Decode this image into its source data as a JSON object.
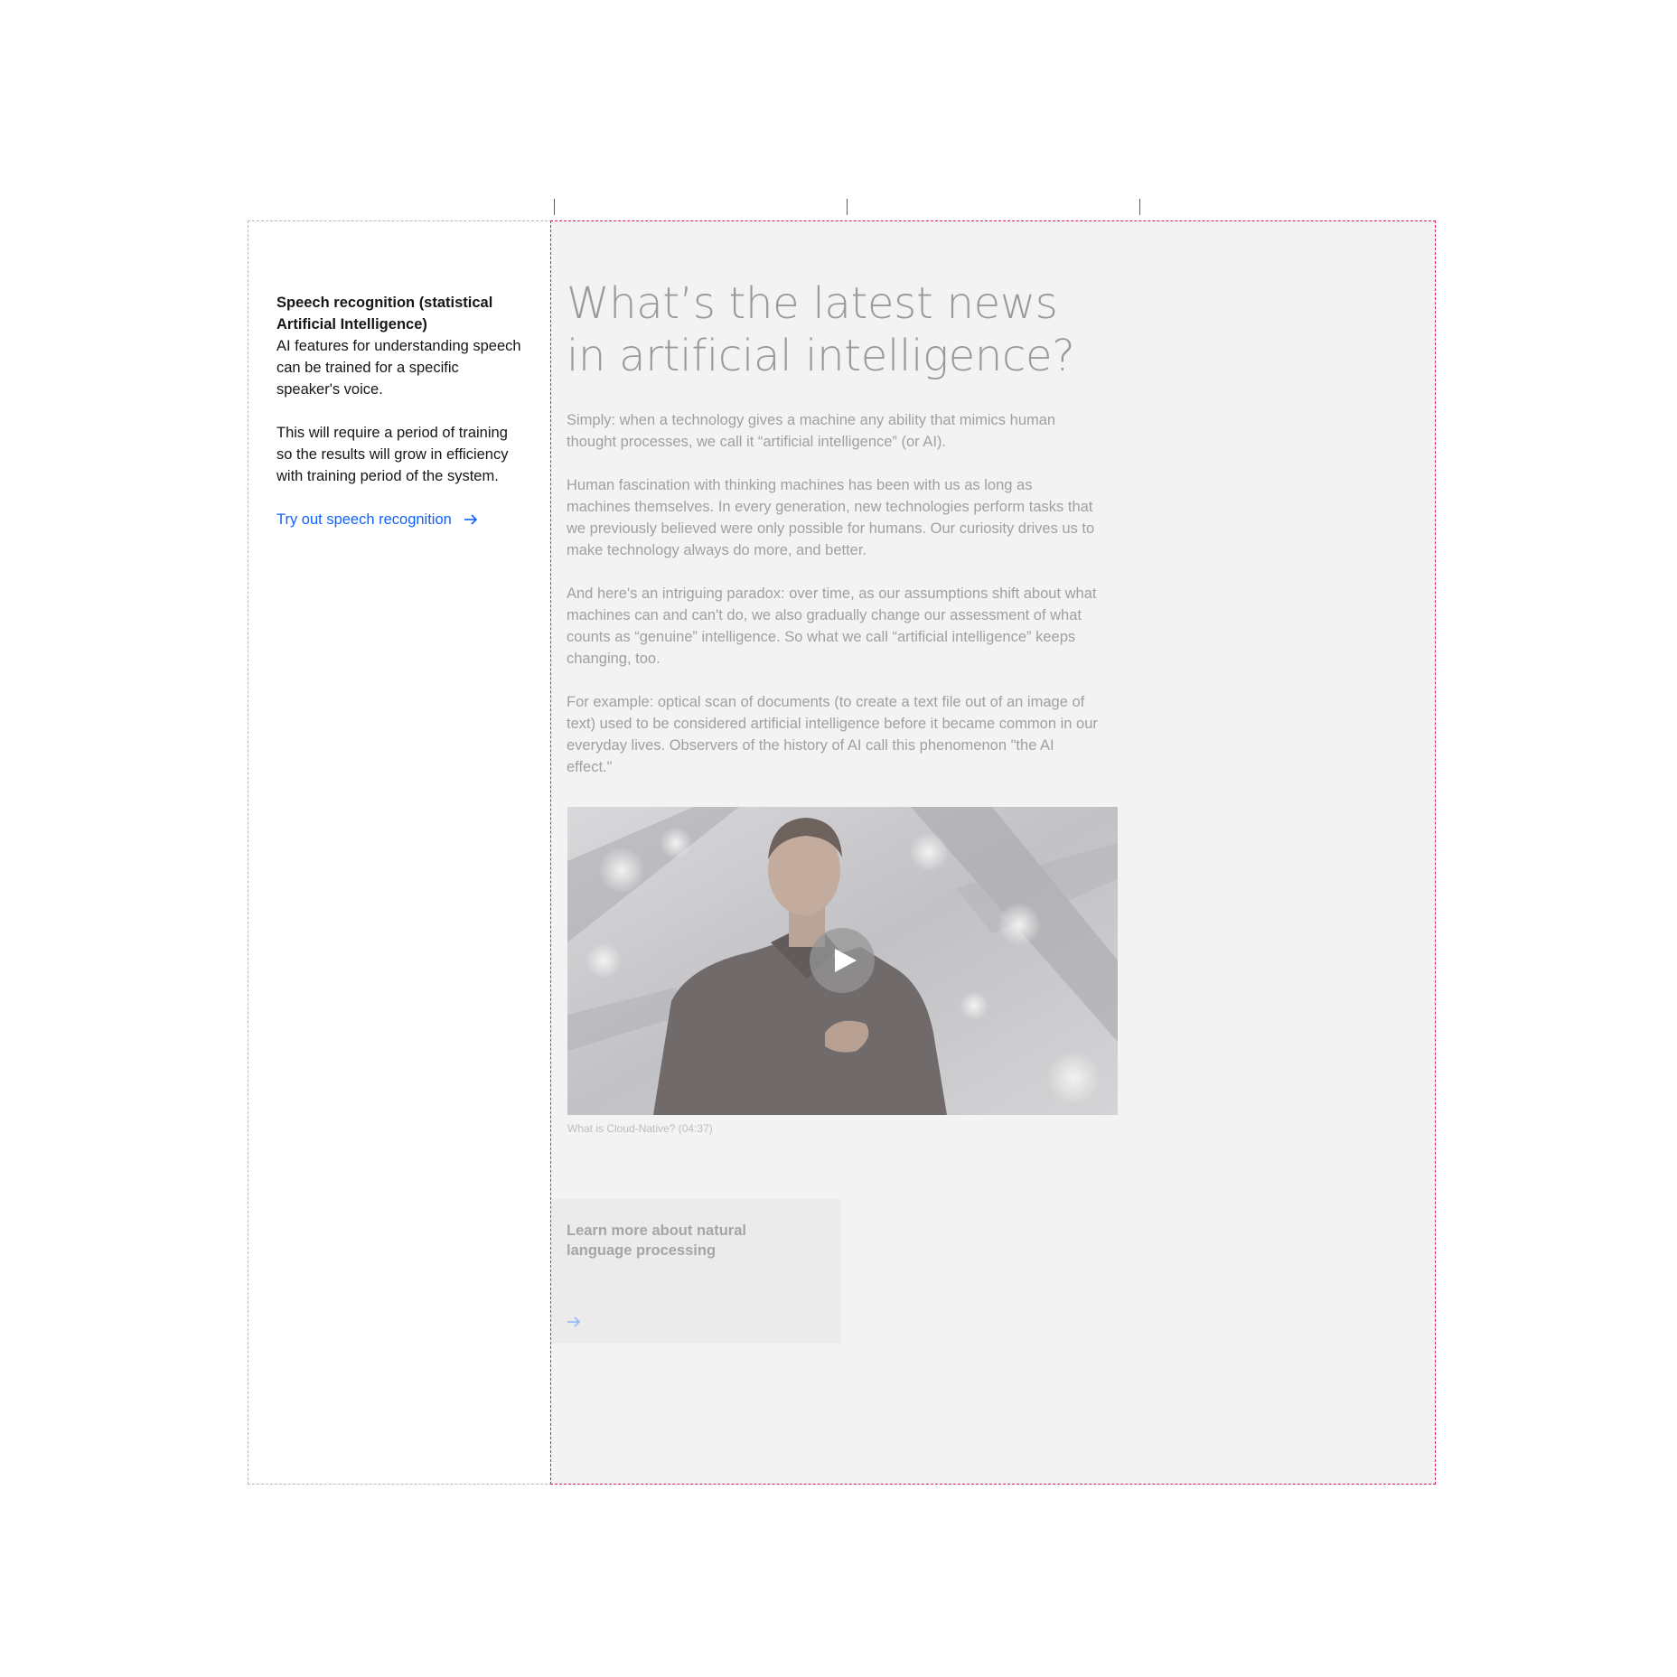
{
  "sidebar": {
    "title": "Speech recognition (statistical Artificial Intelligence)",
    "paragraphs": [
      "AI features for understanding speech can be trained for a specific speaker's voice.",
      "This will require a period of training so the results will grow in efficiency with training period of the system."
    ],
    "link_label": "Try out speech recognition",
    "link_icon": "arrow-right-icon"
  },
  "main": {
    "headline": "What’s the latest news in artificial intelligence?",
    "paragraphs": [
      "Simply: when a technology gives a machine any ability that mimics human thought processes, we call it “artificial intelligence” (or AI).",
      "Human fascination with thinking machines has been with us as long as machines themselves. In every generation, new technologies perform tasks that we previously believed were only possible for humans. Our curiosity drives us to make technology always do more, and better.",
      "And here's an intriguing paradox: over time, as our assumptions shift about what machines can and can't do, we also gradually change our assessment of what counts as “genuine” intelligence. So what we call “artificial intelligence” keeps changing, too.",
      "For example: optical scan of documents (to create a text file out of an image of text) used to be considered artificial intelligence before it became common in our everyday lives. Observers of the history of AI call this phenomenon \"the AI effect.\""
    ],
    "video": {
      "caption": "What is Cloud-Native? (04:37)",
      "play_icon": "play-icon"
    },
    "card": {
      "title": "Learn more about natural language processing",
      "icon": "arrow-right-icon"
    }
  },
  "colors": {
    "accent": "#0f62fe",
    "guide": "#da1e5a",
    "overlay": "#f3f3f3"
  }
}
